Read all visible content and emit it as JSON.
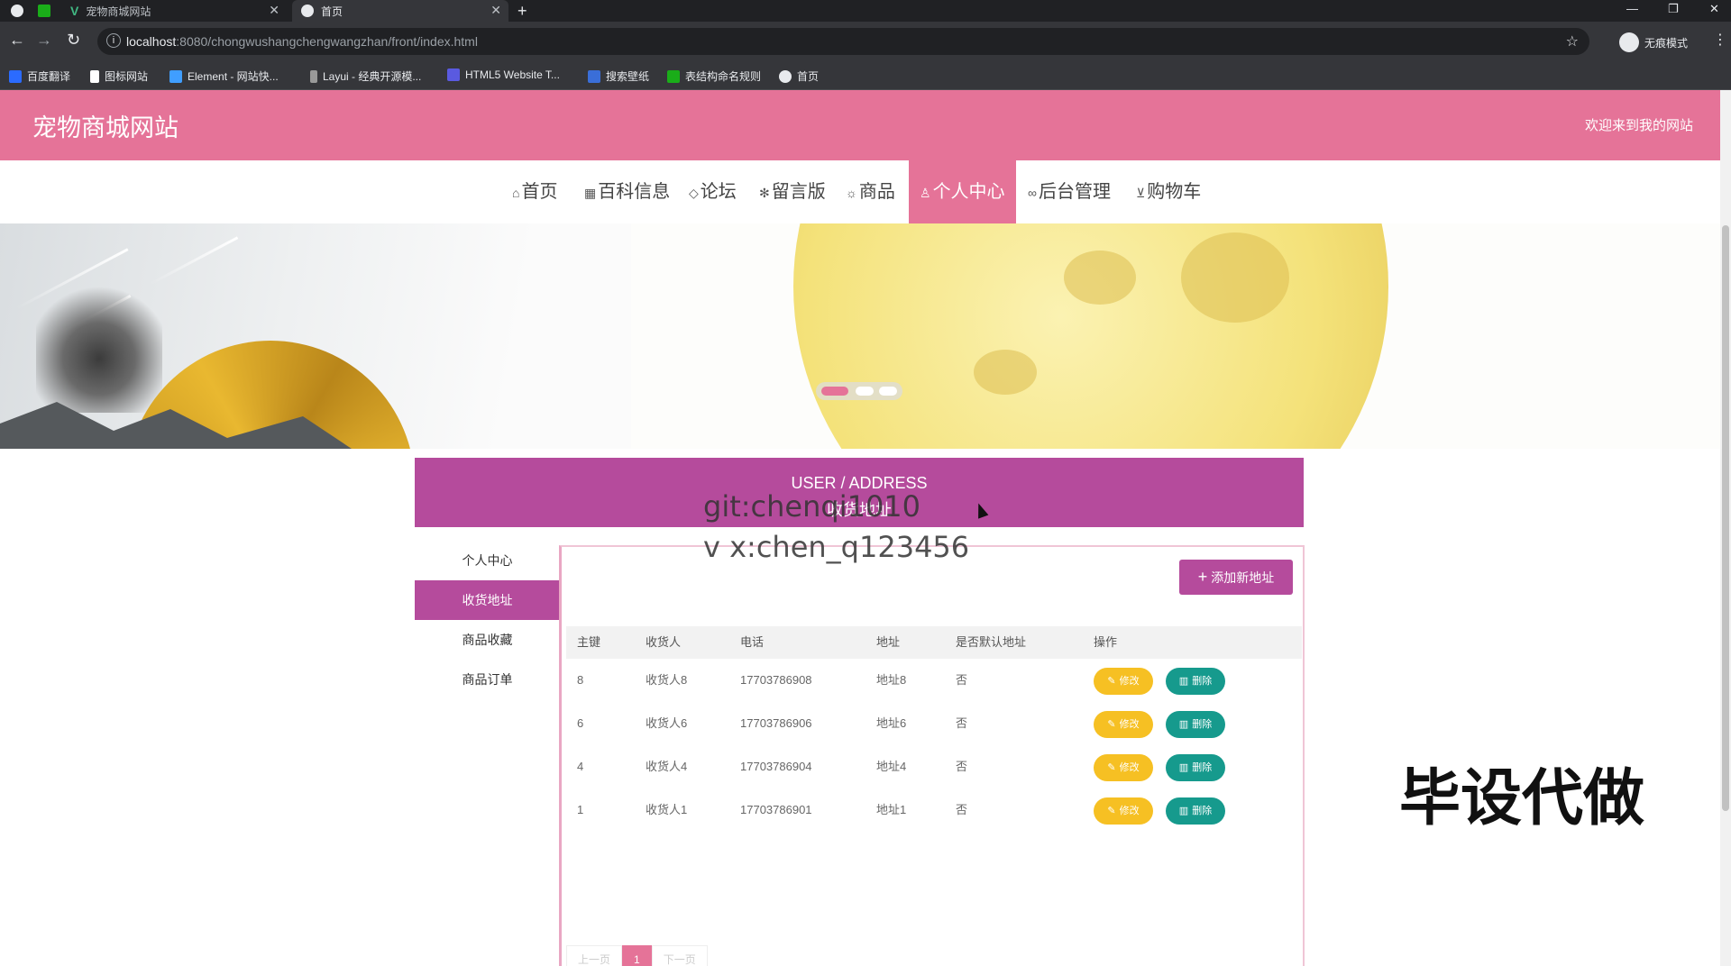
{
  "browser": {
    "tabs": [
      {
        "title": ""
      },
      {
        "title": ""
      },
      {
        "title": "宠物商城网站"
      },
      {
        "title": "首页"
      }
    ],
    "new_tab": "+",
    "url_host": "localhost",
    "url_rest": ":8080/chongwushangchengwangzhan/front/index.html",
    "incognito_label": "无痕模式",
    "bookmarks": [
      "百度翻译",
      "图标网站",
      "Element - 网站快...",
      "Layui - 经典开源模...",
      "HTML5 Website T...",
      "搜索壁纸",
      "表结构命名规则",
      "首页"
    ]
  },
  "site": {
    "title": "宠物商城网站",
    "welcome": "欢迎来到我的网站"
  },
  "nav": [
    {
      "icon": "⌂",
      "label": "首页"
    },
    {
      "icon": "▦",
      "label": "百科信息"
    },
    {
      "icon": "◇",
      "label": "论坛"
    },
    {
      "icon": "✻",
      "label": "留言版"
    },
    {
      "icon": "☼",
      "label": "商品"
    },
    {
      "icon": "♙",
      "label": "个人中心"
    },
    {
      "icon": "∞",
      "label": "后台管理"
    },
    {
      "icon": "⊻",
      "label": "购物车"
    }
  ],
  "page_title": {
    "en": "USER / ADDRESS",
    "cn": "收货地址"
  },
  "sidebar": [
    "个人中心",
    "收货地址",
    "商品收藏",
    "商品订单"
  ],
  "add_button": "添加新地址",
  "table": {
    "headers": [
      "主键",
      "收货人",
      "电话",
      "地址",
      "是否默认地址",
      "操作"
    ],
    "rows": [
      {
        "id": "8",
        "name": "收货人8",
        "phone": "17703786908",
        "addr": "地址8",
        "default": "否"
      },
      {
        "id": "6",
        "name": "收货人6",
        "phone": "17703786906",
        "addr": "地址6",
        "default": "否"
      },
      {
        "id": "4",
        "name": "收货人4",
        "phone": "17703786904",
        "addr": "地址4",
        "default": "否"
      },
      {
        "id": "1",
        "name": "收货人1",
        "phone": "17703786901",
        "addr": "地址1",
        "default": "否"
      }
    ],
    "edit_label": "修改",
    "delete_label": "删除"
  },
  "pager": {
    "prev": "上一页",
    "current": "1",
    "next": "下一页"
  },
  "watermark": {
    "line1": "git:chenqi1010",
    "line2": "v x:chen_q123456",
    "corner": "毕设代做"
  },
  "colors": {
    "brand_pink": "#e57398",
    "accent_purple": "#b54b9c",
    "edit_yellow": "#f6c023",
    "delete_teal": "#169a8d"
  }
}
